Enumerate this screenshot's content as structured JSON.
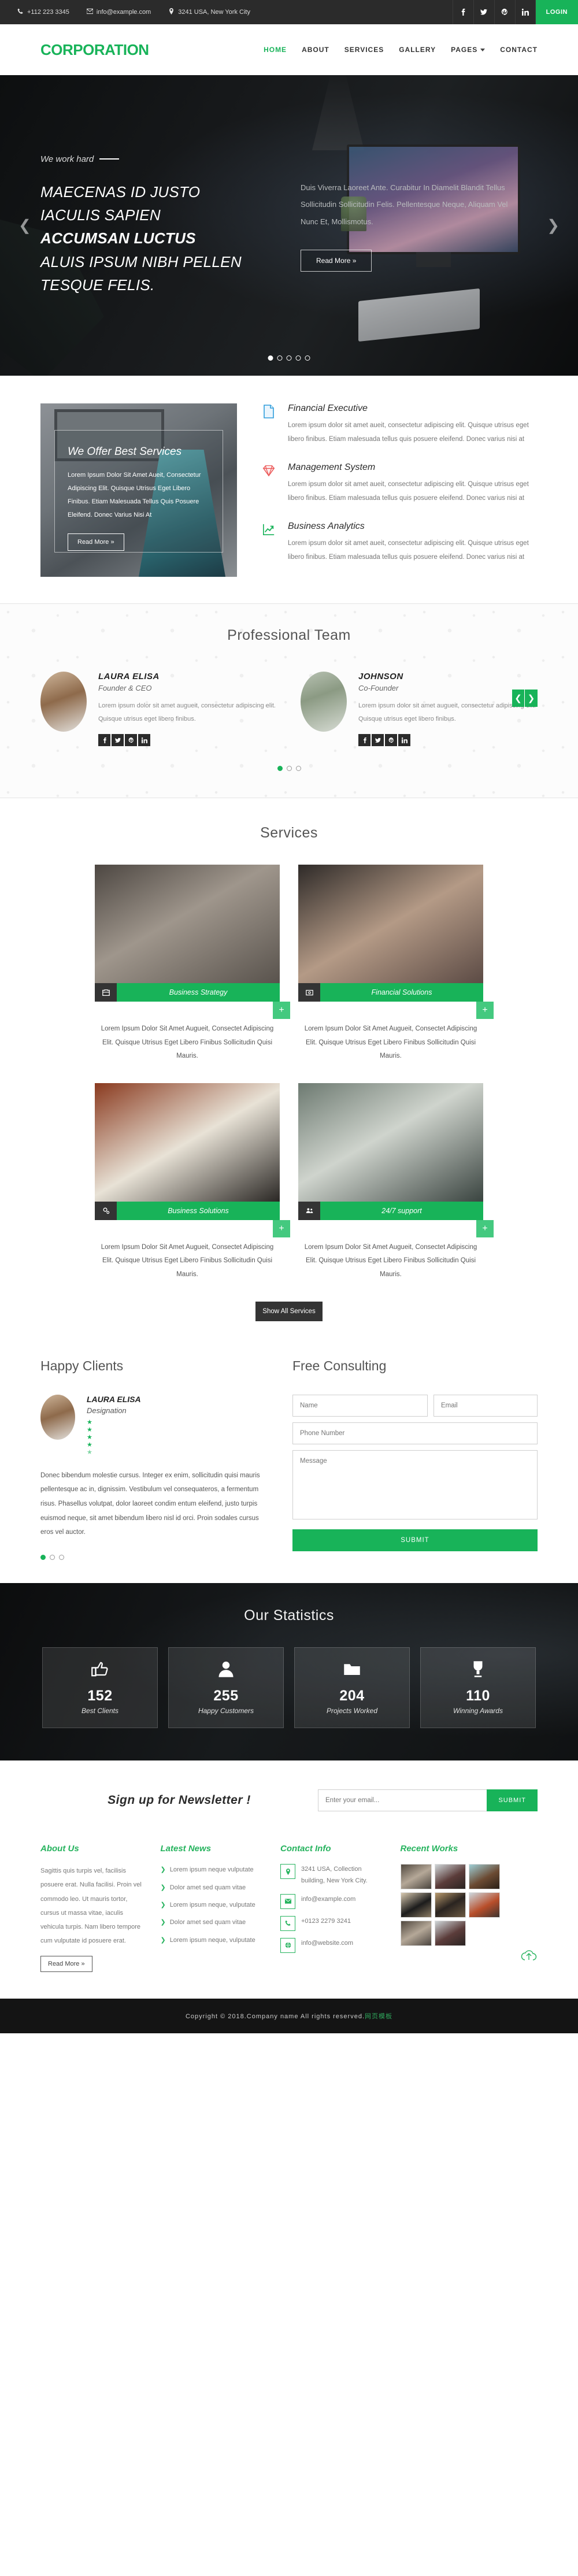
{
  "topbar": {
    "phone": "+112 223 3345",
    "email": "info@example.com",
    "address": "3241 USA, New York City",
    "socials": [
      "facebook-icon",
      "twitter-icon",
      "pinterest-icon",
      "linkedin-icon"
    ],
    "login_label": "LOGIN"
  },
  "nav": {
    "logo": "CORPORATION",
    "items": [
      {
        "label": "HOME",
        "active": true
      },
      {
        "label": "ABOUT",
        "active": false
      },
      {
        "label": "SERVICES",
        "active": false
      },
      {
        "label": "GALLERY",
        "active": false
      },
      {
        "label": "PAGES",
        "active": false,
        "caret": true
      },
      {
        "label": "CONTACT",
        "active": false
      }
    ]
  },
  "hero": {
    "kicker": "We work hard",
    "title_line1": "MAECENAS ID JUSTO",
    "title_line2": "IACULIS SAPIEN",
    "title_bold": "ACCUMSAN LUCTUS",
    "title_line3": "ALUIS IPSUM NIBH PELLEN",
    "title_line4": "TESQUE FELIS.",
    "description": "Duis Viverra Laoreet Ante. Curabitur In Diamelit Blandit Tellus Sollicitudin Sollicitudin Felis. Pellentesque Neque, Aliquam Vel Nunc Et, Mollismotus.",
    "cta": "Read More »",
    "prev": "❮",
    "next": "❯",
    "slides": 5,
    "active_slide": 1
  },
  "offer": {
    "title": "We Offer Best Services",
    "body": "Lorem Ipsum Dolor Sit Amet Aueit, Consectetur Adipiscing Elit. Quisque Utrisus Eget Libero Finibus. Etiam Malesuada Tellus Quis Posuere Eleifend. Donec Varius Nisi At",
    "cta": "Read More »"
  },
  "features": [
    {
      "icon": "document-icon",
      "color": "#2d9cdb",
      "title": "Financial Executive",
      "body": "Lorem ipsum dolor sit amet aueit, consectetur adipiscing elit. Quisque utrisus eget libero finibus. Etiam malesuada tellus quis posuere eleifend. Donec varius nisi at"
    },
    {
      "icon": "diamond-icon",
      "color": "#eb5757",
      "title": "Management System",
      "body": "Lorem ipsum dolor sit amet aueit, consectetur adipiscing elit. Quisque utrisus eget libero finibus. Etiam malesuada tellus quis posuere eleifend. Donec varius nisi at"
    },
    {
      "icon": "chart-up-icon",
      "color": "#18b359",
      "title": "Business Analytics",
      "body": "Lorem ipsum dolor sit amet aueit, consectetur adipiscing elit. Quisque utrisus eget libero finibus. Etiam malesuada tellus quis posuere eleifend. Donec varius nisi at"
    }
  ],
  "team": {
    "title": "Professional Team",
    "prev": "❮",
    "next": "❯",
    "members": [
      {
        "name": "LAURA ELISA",
        "role": "Founder & CEO",
        "bio": "Lorem ipsum dolor sit amet augueit, consectetur adipiscing elit. Quisque utrisus eget libero finibus.",
        "socials": [
          "facebook-icon",
          "twitter-icon",
          "pinterest-icon",
          "linkedin-icon"
        ]
      },
      {
        "name": "JOHNSON",
        "role": "Co-Founder",
        "bio": "Lorem ipsum dolor sit amet augueit, consectetur adipiscing elit. Quisque utrisus eget libero finibus.",
        "socials": [
          "facebook-icon",
          "twitter-icon",
          "pinterest-icon",
          "linkedin-icon"
        ]
      }
    ],
    "dots": 3,
    "active_dot": 1
  },
  "services": {
    "title": "Services",
    "show_all": "Show All Services",
    "items": [
      {
        "label": "Business Strategy",
        "icon": "briefcase-icon",
        "body": "Lorem Ipsum Dolor Sit Amet Augueit, Consectet Adipiscing Elit. Quisque Utrisus Eget Libero Finibus Sollicitudin Quisi Mauris.",
        "plus": "+"
      },
      {
        "label": "Financial Solutions",
        "icon": "money-icon",
        "body": "Lorem Ipsum Dolor Sit Amet Augueit, Consectet Adipiscing Elit. Quisque Utrisus Eget Libero Finibus Sollicitudin Quisi Mauris.",
        "plus": "+"
      },
      {
        "label": "Business Solutions",
        "icon": "gears-icon",
        "body": "Lorem Ipsum Dolor Sit Amet Augueit, Consectet Adipiscing Elit. Quisque Utrisus Eget Libero Finibus Sollicitudin Quisi Mauris.",
        "plus": "+"
      },
      {
        "label": "24/7 support",
        "icon": "users-icon",
        "body": "Lorem Ipsum Dolor Sit Amet Augueit, Consectet Adipiscing Elit. Quisque Utrisus Eget Libero Finibus Sollicitudin Quisi Mauris.",
        "plus": "+"
      }
    ]
  },
  "clients": {
    "title": "Happy Clients",
    "name": "LAURA ELISA",
    "role": "Designation",
    "rating": 4.5,
    "body": "Donec bibendum molestie cursus. Integer ex enim, sollicitudin quisi mauris pellentesque ac in, dignissim. Vestibulum vel consequateros, a fermentum risus. Phasellus volutpat, dolor laoreet condim entum eleifend, justo turpis euismod neque, sit amet bibendum libero nisl id orci. Proin sodales cursus eros vel auctor.",
    "dots": 3,
    "active_dot": 1
  },
  "consulting": {
    "title": "Free Consulting",
    "name_placeholder": "Name",
    "email_placeholder": "Email",
    "phone_placeholder": "Phone Number",
    "message_placeholder": "Message",
    "submit": "SUBMIT"
  },
  "stats": {
    "title": "Our Statistics",
    "items": [
      {
        "icon": "thumbs-up-icon",
        "number": "152",
        "label": "Best Clients"
      },
      {
        "icon": "person-icon",
        "number": "255",
        "label": "Happy Customers"
      },
      {
        "icon": "folder-icon",
        "number": "204",
        "label": "Projects Worked"
      },
      {
        "icon": "trophy-icon",
        "number": "110",
        "label": "Winning Awards"
      }
    ]
  },
  "newsletter": {
    "title": "Sign up for Newsletter !",
    "placeholder": "Enter your email...",
    "submit": "SUBMIT"
  },
  "footer": {
    "about": {
      "title": "About Us",
      "body": "Sagittis quis turpis vel, facilisis posuere erat. Nulla facilisi. Proin vel commodo leo. Ut mauris tortor, cursus ut massa vitae, iaculis vehicula turpis. Nam libero tempore cum vulputate id posuere erat.",
      "cta": "Read More »"
    },
    "news": {
      "title": "Latest News",
      "items": [
        "Lorem ipsum neque vulputate",
        "Dolor amet sed quam vitae",
        "Lorem ipsum neque, vulputate",
        "Dolor amet sed quam vitae",
        "Lorem ipsum neque, vulputate"
      ]
    },
    "contact": {
      "title": "Contact Info",
      "items": [
        {
          "icon": "map-pin-icon",
          "text": "3241 USA, Collection building, New York City."
        },
        {
          "icon": "envelope-icon",
          "text": "info@example.com"
        },
        {
          "icon": "phone-icon",
          "text": "+0123 2279 3241"
        },
        {
          "icon": "globe-icon",
          "text": "info@website.com"
        }
      ]
    },
    "works": {
      "title": "Recent Works",
      "count": 8
    },
    "back_to_top": "back-to-top-icon"
  },
  "copyright": {
    "text": "Copyright © 2018.Company name All rights reserved.",
    "suffix": "网页模板"
  },
  "colors": {
    "accent": "#18b359",
    "dark": "#2b2b2b",
    "footer_green": "#26b35e"
  }
}
